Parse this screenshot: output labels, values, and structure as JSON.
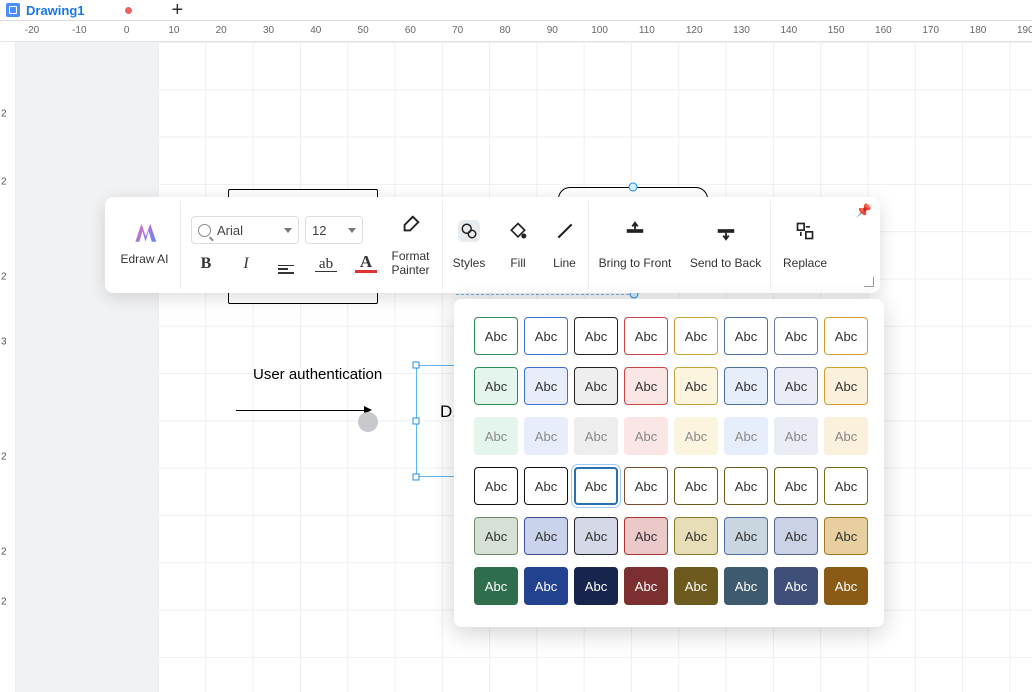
{
  "tab": {
    "title": "Drawing1"
  },
  "ruler": {
    "values": [
      -20,
      -10,
      0,
      10,
      20,
      30,
      40,
      50,
      60,
      70,
      80,
      90,
      100,
      110,
      120,
      130,
      140,
      150,
      160,
      170,
      180,
      190
    ]
  },
  "vruler": {
    "values": [
      2,
      2,
      2,
      3,
      2,
      2,
      2
    ]
  },
  "toolbar": {
    "ai_label": "Edraw AI",
    "font_name": "Arial",
    "font_size": "12",
    "format_painter": "Format\nPainter",
    "styles": "Styles",
    "fill": "Fill",
    "line": "Line",
    "bring_front": "Bring to Front",
    "send_back": "Send to Back",
    "replace": "Replace",
    "bold_glyph": "B",
    "italic_glyph": "I",
    "strike_glyph": "ab",
    "color_glyph": "A"
  },
  "canvas": {
    "annotation": "User authentication",
    "partial_label": "D."
  },
  "styles_popover": {
    "sample": "Abc",
    "rows": [
      {
        "kind": "outline",
        "colors": [
          "#2e8b57",
          "#3d6fd1",
          "#222",
          "#c44",
          "#caa23a",
          "#4a6fa1",
          "#6a7aa8",
          "#cf9f2d"
        ]
      },
      {
        "kind": "tint",
        "colors": [
          {
            "bg": "#e4f5ec",
            "bd": "#2e8b57"
          },
          {
            "bg": "#e7edfb",
            "bd": "#3d6fd1"
          },
          {
            "bg": "#eeeeee",
            "bd": "#222"
          },
          {
            "bg": "#fbe6e6",
            "bd": "#c44"
          },
          {
            "bg": "#fbf4df",
            "bd": "#caa23a"
          },
          {
            "bg": "#e7eefb",
            "bd": "#4a6fa1"
          },
          {
            "bg": "#eaecf6",
            "bd": "#6a7aa8"
          },
          {
            "bg": "#fbf0dc",
            "bd": "#cf9f2d"
          }
        ]
      },
      {
        "kind": "soft",
        "colors": [
          "#e4f5ec",
          "#e7edfb",
          "#eeeeee",
          "#fbe6e6",
          "#fbf4df",
          "#e7eefb",
          "#eaecf6",
          "#fbf0dc"
        ],
        "text": "#888"
      },
      {
        "kind": "outline",
        "colors": [
          "#111",
          "#111",
          "#2b6fb3",
          "#7a4a2a",
          "#6b5a1d",
          "#6b5a1d",
          "#6b5a1d",
          "#7a6a1d"
        ],
        "double_index": 2
      },
      {
        "kind": "tint",
        "colors": [
          {
            "bg": "#d7e0d7",
            "bd": "#6b8b6b"
          },
          {
            "bg": "#c9d3ec",
            "bd": "#3d4f8a"
          },
          {
            "bg": "#d5d8e6",
            "bd": "#222"
          },
          {
            "bg": "#ecc9c9",
            "bd": "#a33"
          },
          {
            "bg": "#e7ddb6",
            "bd": "#8a7a2a"
          },
          {
            "bg": "#c9d5df",
            "bd": "#4a6fa1"
          },
          {
            "bg": "#ccd2e6",
            "bd": "#55628a"
          },
          {
            "bg": "#e7cf9f",
            "bd": "#a6781f"
          }
        ]
      },
      {
        "kind": "solid",
        "colors": [
          "#2f6e4c",
          "#22418f",
          "#17244d",
          "#7c2f2f",
          "#6c5a1f",
          "#3e5a6e",
          "#3f4f7a",
          "#8a5a17"
        ]
      }
    ]
  }
}
